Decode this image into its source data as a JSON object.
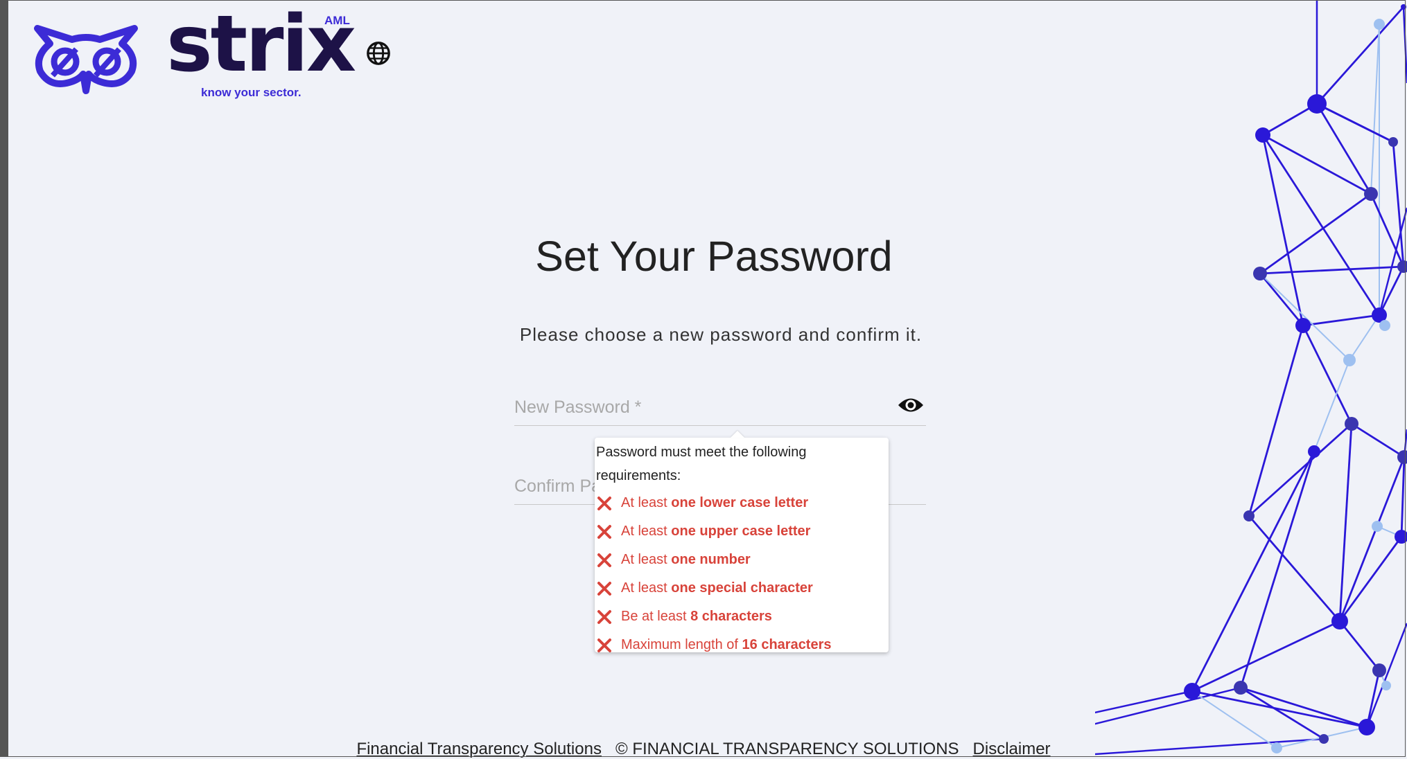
{
  "brand": {
    "name": "strix",
    "superscript": "AML",
    "tagline": "know your sector.",
    "color_primary": "#3c2bd6",
    "color_dark": "#1d1247"
  },
  "header": {
    "language_icon": "globe-icon"
  },
  "main": {
    "title": "Set Your Password",
    "subtitle": "Please choose a new password and confirm it.",
    "new_password_placeholder": "New Password *",
    "confirm_password_placeholder": "Confirm Password *",
    "visibility_icon": "eye-icon"
  },
  "requirements": {
    "heading_line1": "Password must meet the following",
    "heading_line2": "requirements:",
    "status_icon": "x-mark-icon",
    "status_color": "#d8433a",
    "items": [
      {
        "prefix": "At least ",
        "emphasis": "one lower case letter",
        "suffix": "",
        "met": false
      },
      {
        "prefix": "At least ",
        "emphasis": "one upper case letter",
        "suffix": "",
        "met": false
      },
      {
        "prefix": "At least ",
        "emphasis": "one number",
        "suffix": "",
        "met": false
      },
      {
        "prefix": "At least ",
        "emphasis": "one special character",
        "suffix": "",
        "met": false
      },
      {
        "prefix": "Be at least ",
        "emphasis": "8 characters",
        "suffix": "",
        "met": false
      },
      {
        "prefix": "Maximum length of ",
        "emphasis": "16 characters",
        "suffix": "",
        "met": false
      }
    ]
  },
  "footer": {
    "company_link": "Financial Transparency Solutions",
    "copyright": "© FINANCIAL TRANSPARENCY SOLUTIONS",
    "disclaimer_link": "Disclaimer"
  }
}
